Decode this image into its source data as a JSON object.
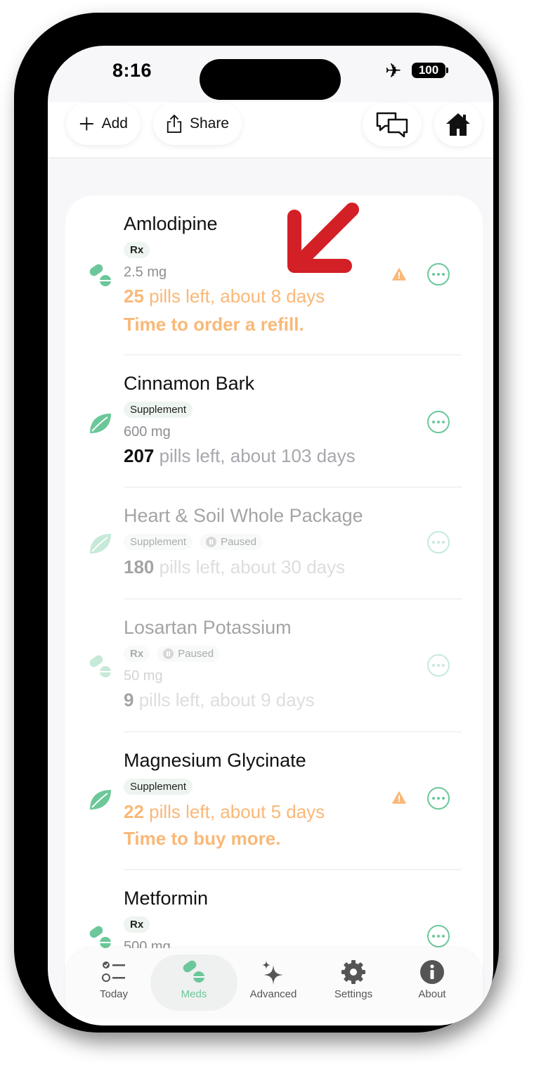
{
  "status_bar": {
    "time": "8:16",
    "battery": "100"
  },
  "header": {
    "add_label": "Add",
    "share_label": "Share"
  },
  "meds": [
    {
      "name": "Amlodipine",
      "tags": [
        "Rx"
      ],
      "dose": "2.5 mg",
      "count": "25",
      "count_suffix": " pills left, about 8 days",
      "alert": "Time to order a refill.",
      "warning": true,
      "paused": false,
      "type_icon": "pill-icon"
    },
    {
      "name": "Cinnamon Bark",
      "tags": [
        "Supplement"
      ],
      "dose": "600 mg",
      "count": "207",
      "count_suffix": " pills left, about 103 days",
      "alert": "",
      "warning": false,
      "paused": false,
      "type_icon": "leaf-icon"
    },
    {
      "name": "Heart & Soil Whole Package",
      "tags": [
        "Supplement",
        "Paused"
      ],
      "dose": "",
      "count": "180",
      "count_suffix": " pills left, about 30 days",
      "alert": "",
      "warning": false,
      "paused": true,
      "type_icon": "leaf-icon"
    },
    {
      "name": "Losartan Potassium",
      "tags": [
        "Rx",
        "Paused"
      ],
      "dose": "50 mg",
      "count": "9",
      "count_suffix": " pills left, about 9 days",
      "alert": "",
      "warning": false,
      "paused": true,
      "type_icon": "pill-icon"
    },
    {
      "name": "Magnesium Glycinate",
      "tags": [
        "Supplement"
      ],
      "dose": "",
      "count": "22",
      "count_suffix": " pills left, about 5 days",
      "alert": "Time to buy more.",
      "warning": true,
      "paused": false,
      "type_icon": "leaf-icon"
    },
    {
      "name": "Metformin",
      "tags": [
        "Rx"
      ],
      "dose": "500 mg",
      "count": "",
      "count_suffix": "",
      "alert": "",
      "warning": false,
      "paused": false,
      "type_icon": "pill-icon"
    }
  ],
  "tabs": [
    {
      "label": "Today",
      "icon": "checklist-icon",
      "active": false
    },
    {
      "label": "Meds",
      "icon": "pill-icon",
      "active": true
    },
    {
      "label": "Advanced",
      "icon": "sparkles-icon",
      "active": false
    },
    {
      "label": "Settings",
      "icon": "gear-icon",
      "active": false
    },
    {
      "label": "About",
      "icon": "info-icon",
      "active": false
    }
  ],
  "colors": {
    "accent": "#6cc79a",
    "warning": "#f9b878",
    "arrow": "#d32026"
  }
}
